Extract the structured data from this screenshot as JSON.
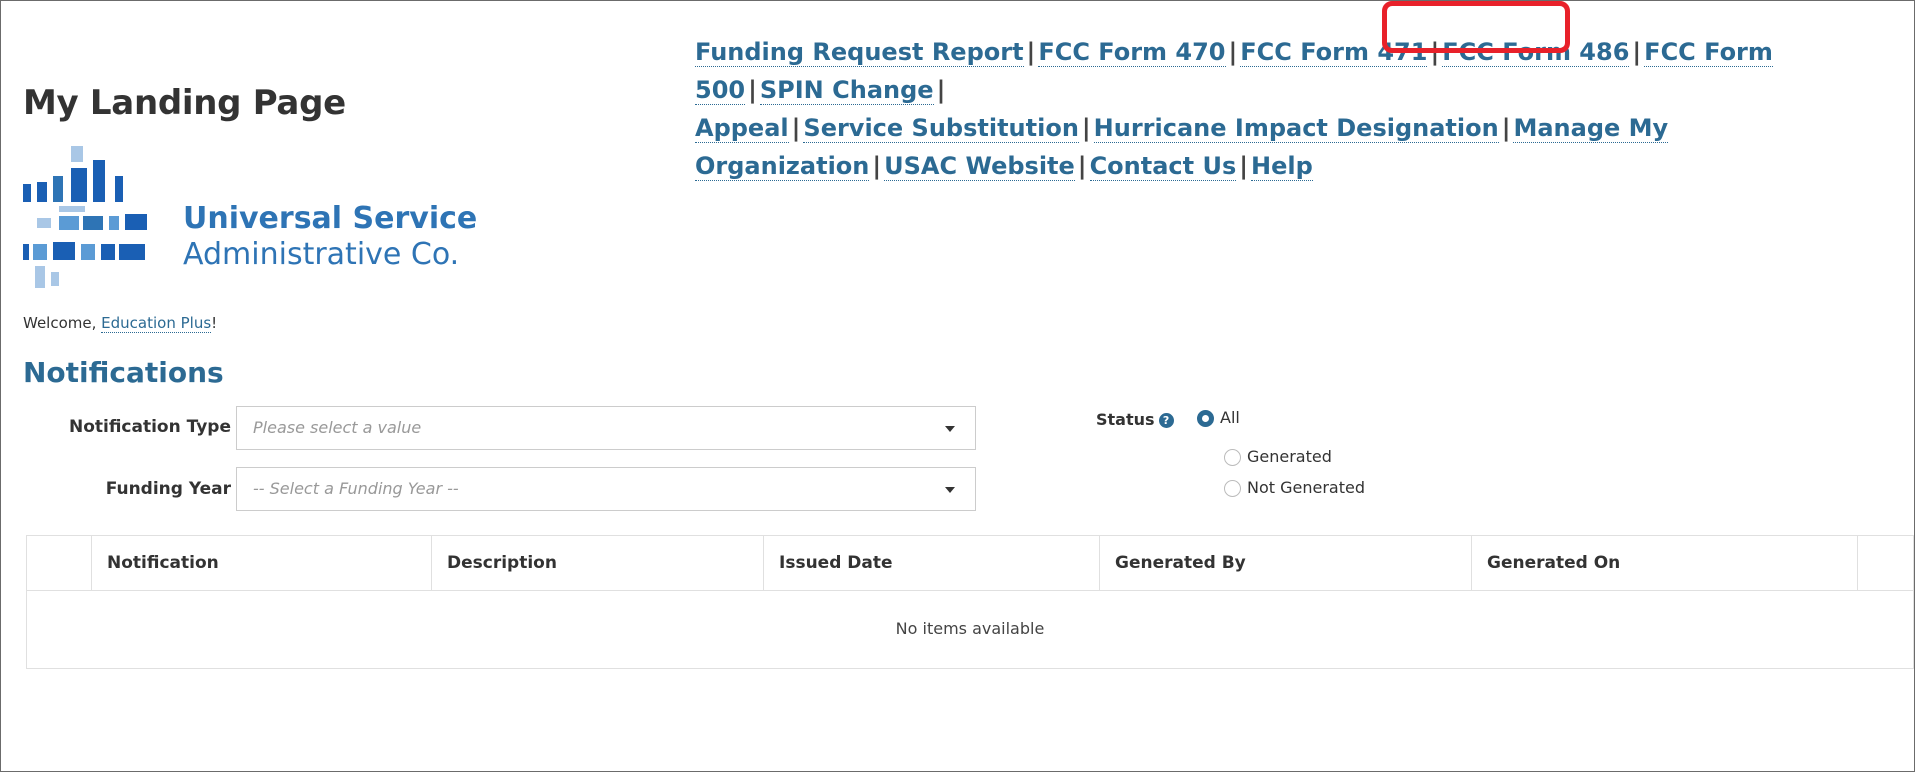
{
  "header": {
    "page_title": "My Landing Page",
    "nav_links": [
      "Funding Request Report",
      "FCC Form 470",
      "FCC Form 471",
      "FCC Form 486",
      "FCC Form 500",
      "SPIN Change",
      "Appeal",
      "Service Substitution",
      "Hurricane Impact Designation",
      "Manage My Organization",
      "USAC Website",
      "Contact Us",
      "Help"
    ],
    "separator": "|",
    "highlighted_link": "FCC Form 486",
    "highlight_color": "#e8212a"
  },
  "logo": {
    "line1": "Universal Service",
    "line2": "Administrative Co.",
    "color": "#2e74b5"
  },
  "welcome": {
    "prefix": "Welcome, ",
    "user": "Education Plus",
    "suffix": "!"
  },
  "notifications": {
    "title": "Notifications",
    "notification_type": {
      "label": "Notification Type",
      "placeholder": "Please select a value"
    },
    "funding_year": {
      "label": "Funding Year",
      "placeholder": "-- Select a Funding Year --"
    },
    "status": {
      "label": "Status",
      "help_icon": "question-circle-icon",
      "options": [
        "All",
        "Generated",
        "Not Generated"
      ],
      "selected": "All"
    },
    "table": {
      "columns": [
        "Notification",
        "Description",
        "Issued Date",
        "Generated By",
        "Generated On"
      ],
      "rows": [],
      "empty_message": "No items available"
    }
  },
  "colors": {
    "link": "#2c6a93",
    "heading": "#2c6a93",
    "logo_blue": "#2e74b5"
  }
}
